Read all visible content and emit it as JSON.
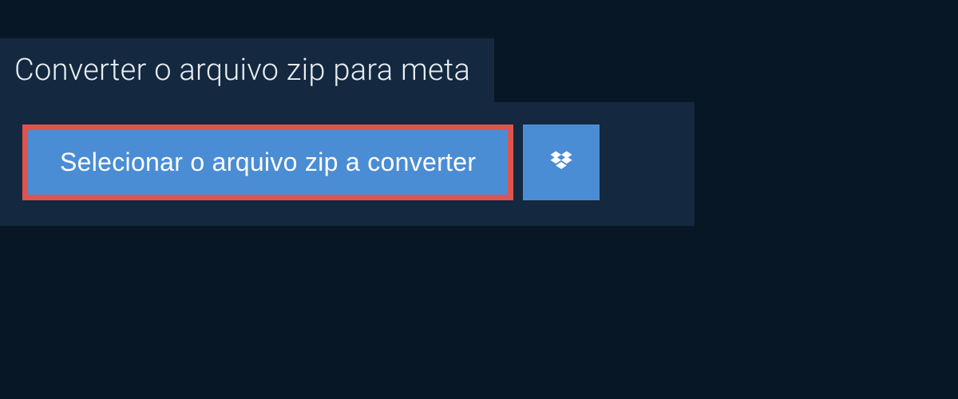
{
  "header": {
    "title": "Converter o arquivo zip para meta"
  },
  "actions": {
    "select_file_label": "Selecionar o arquivo zip a converter",
    "dropbox_icon_name": "dropbox-icon"
  },
  "colors": {
    "page_bg": "#081726",
    "panel_bg": "#14293f",
    "button_bg": "#4b8dd4",
    "highlight_border": "#e0544c",
    "text_light": "#e8eef5"
  }
}
